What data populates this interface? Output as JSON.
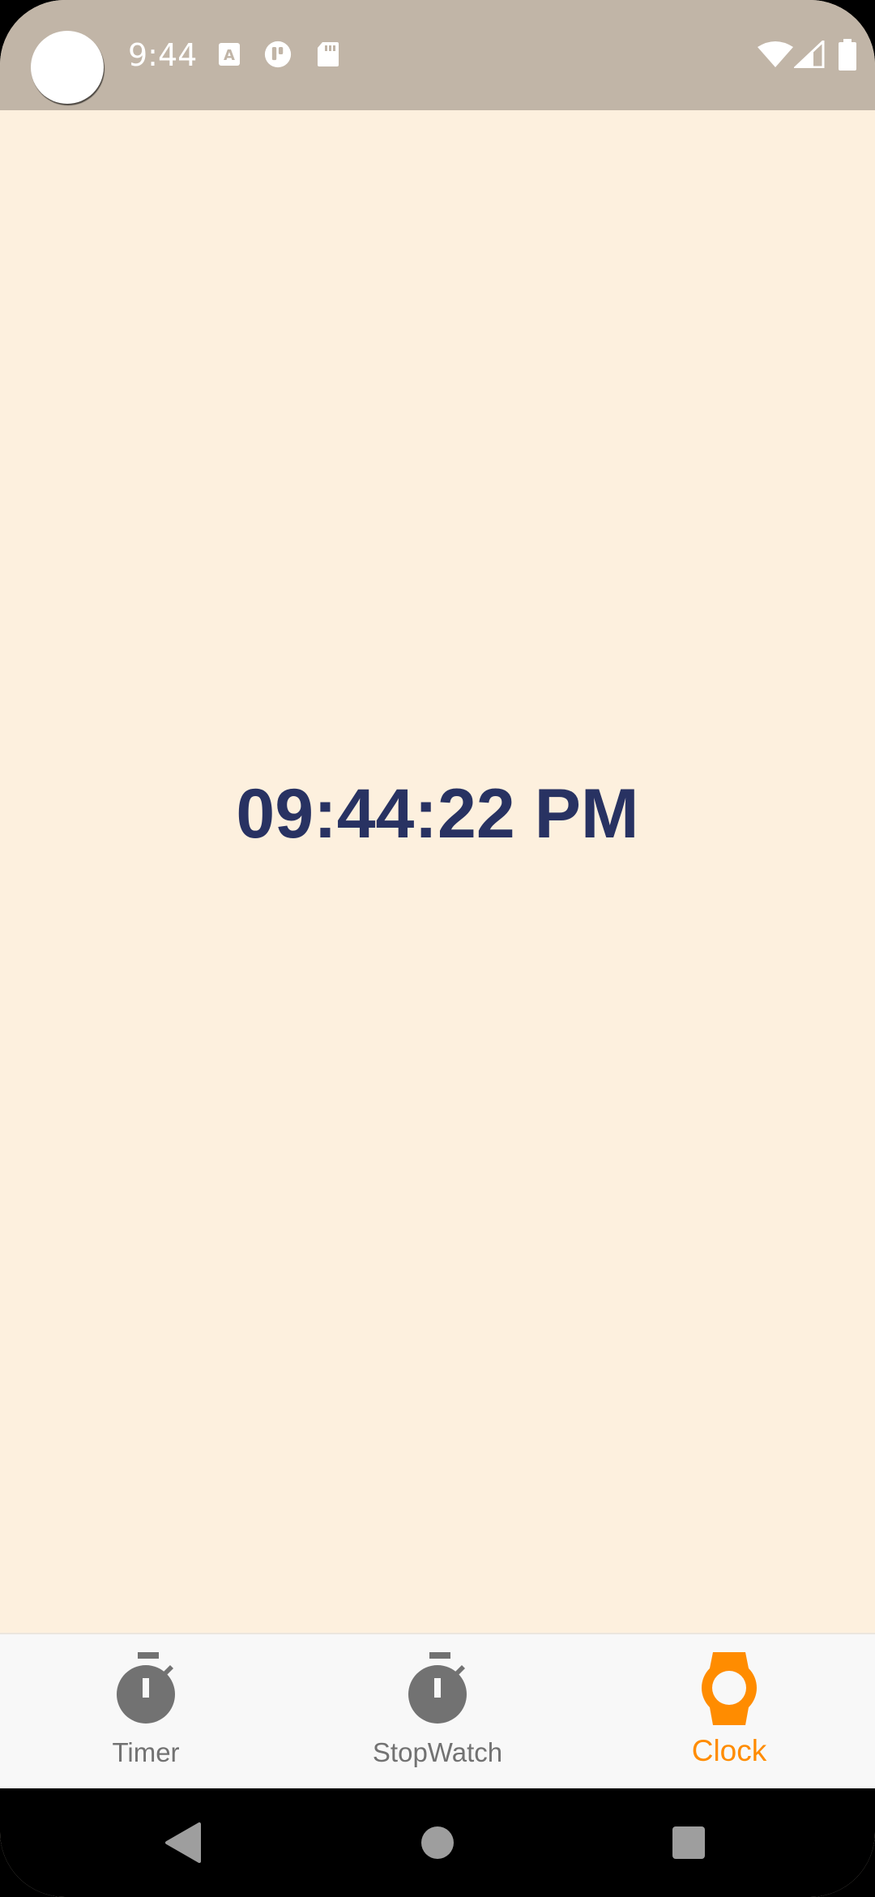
{
  "status_bar": {
    "time": "9:44",
    "icons": [
      "a-icon",
      "app-icon",
      "sd-card-icon",
      "wifi-icon",
      "signal-icon",
      "battery-icon"
    ]
  },
  "main": {
    "clock_time": "09:44:22 PM"
  },
  "bottom_nav": {
    "items": [
      {
        "label": "Timer",
        "icon": "stopwatch-icon",
        "active": false
      },
      {
        "label": "StopWatch",
        "icon": "stopwatch-icon",
        "active": false
      },
      {
        "label": "Clock",
        "icon": "watch-icon",
        "active": true
      }
    ]
  },
  "system_nav": {
    "buttons": [
      "back-icon",
      "home-icon",
      "recents-icon"
    ]
  },
  "colors": {
    "background": "#FDF0DE",
    "status_bar": "#C1B5A7",
    "clock_text": "#283262",
    "accent": "#FF8C00",
    "inactive": "#727272"
  }
}
